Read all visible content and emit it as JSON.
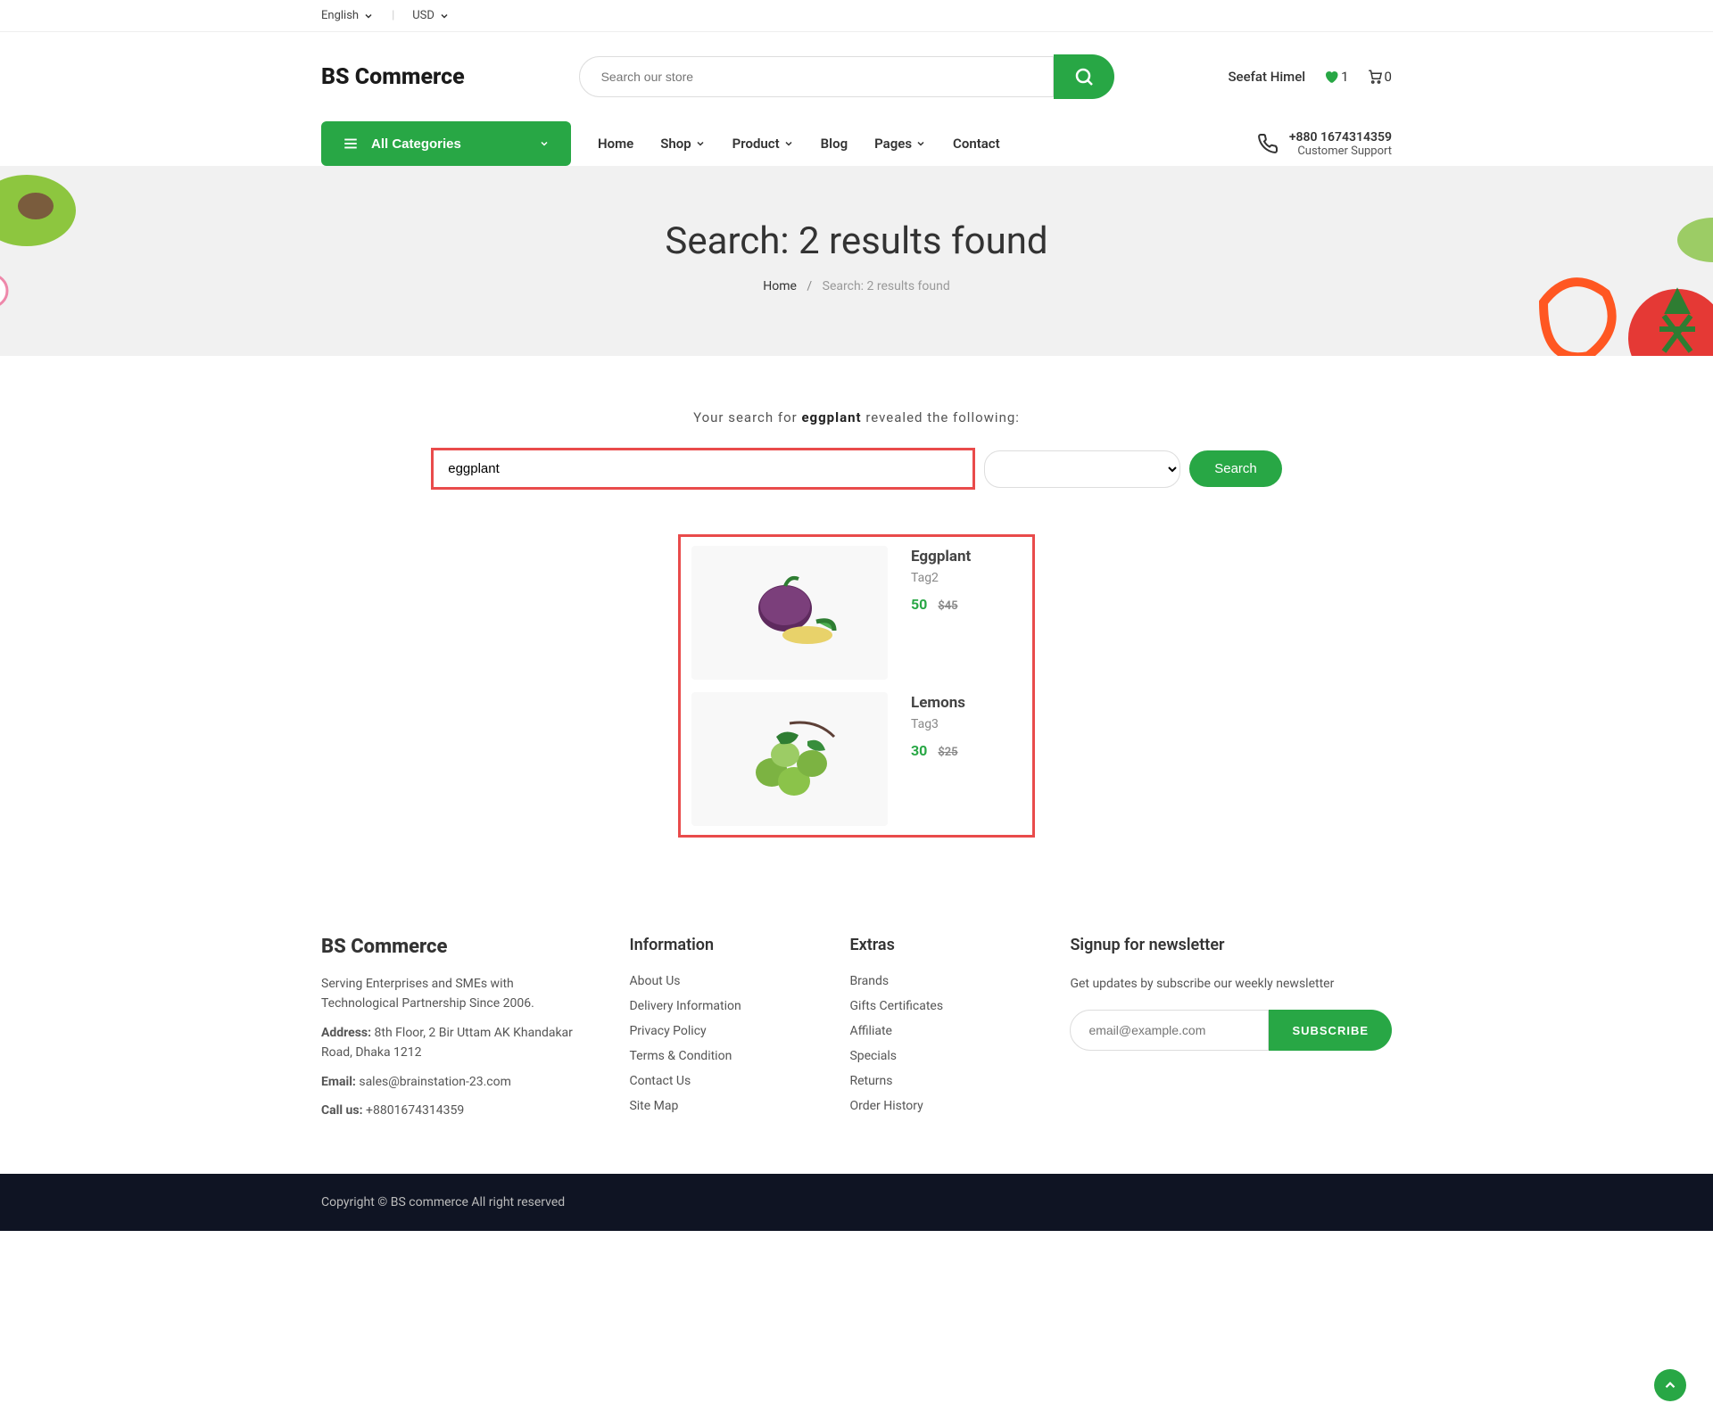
{
  "topbar": {
    "language": "English",
    "currency": "USD"
  },
  "header": {
    "logo": "BS Commerce",
    "search_placeholder": "Search our store",
    "user_name": "Seefat Himel",
    "wishlist_count": "1",
    "cart_count": "0"
  },
  "nav": {
    "categories_label": "All Categories",
    "links": {
      "home": "Home",
      "shop": "Shop",
      "product": "Product",
      "blog": "Blog",
      "pages": "Pages",
      "contact": "Contact"
    },
    "phone": "+880 1674314359",
    "support": "Customer Support"
  },
  "banner": {
    "title": "Search: 2 results found",
    "breadcrumb_home": "Home",
    "breadcrumb_current": "Search: 2 results found"
  },
  "search": {
    "msg_prefix": "Your search for ",
    "msg_term": "eggplant",
    "msg_suffix": " revealed the following:",
    "field_value": "eggplant",
    "button": "Search"
  },
  "results": [
    {
      "name": "Eggplant",
      "tag": "Tag2",
      "price": "50",
      "old_price": "$45"
    },
    {
      "name": "Lemons",
      "tag": "Tag3",
      "price": "30",
      "old_price": "$25"
    }
  ],
  "footer": {
    "brand": "BS Commerce",
    "tagline": "Serving Enterprises and SMEs with Technological Partnership Since 2006.",
    "address_label": "Address:",
    "address": "8th Floor, 2 Bir Uttam AK Khandakar Road, Dhaka 1212",
    "email_label": "Email:",
    "email": "sales@brainstation-23.com",
    "phone_label": "Call us:",
    "phone": "+8801674314359",
    "info_title": "Information",
    "info": {
      "about": "About Us",
      "delivery": "Delivery Information",
      "privacy": "Privacy Policy",
      "terms": "Terms & Condition",
      "contact": "Contact Us",
      "sitemap": "Site Map"
    },
    "extras_title": "Extras",
    "extras": {
      "brands": "Brands",
      "gifts": "Gifts Certificates",
      "affiliate": "Affiliate",
      "specials": "Specials",
      "returns": "Returns",
      "orders": "Order History"
    },
    "newsletter_title": "Signup for newsletter",
    "newsletter_sub": "Get updates by subscribe our weekly newsletter",
    "newsletter_placeholder": "email@example.com",
    "newsletter_btn": "SUBSCRIBE"
  },
  "bottom": {
    "copyright": "Copyright © BS commerce All right reserved"
  }
}
